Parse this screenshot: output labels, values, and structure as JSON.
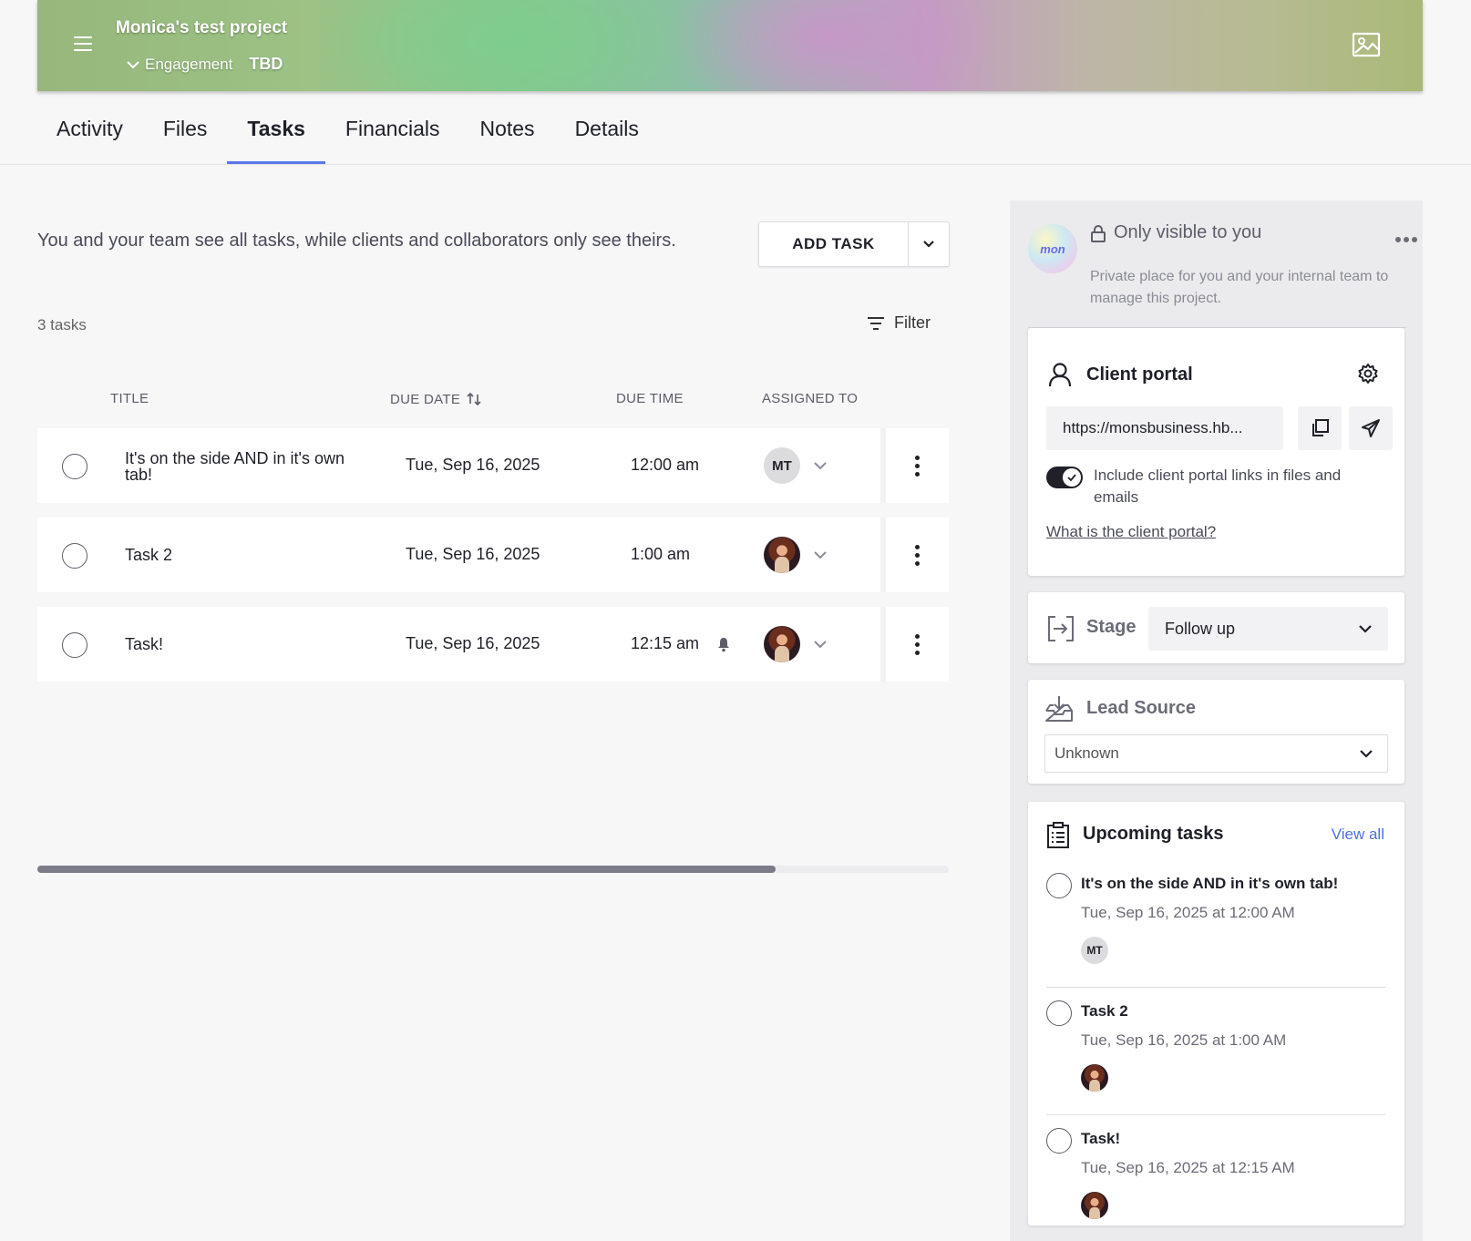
{
  "banner": {
    "project_title": "Monica's test project",
    "stage_type": "Engagement",
    "stage_value": "TBD"
  },
  "tabs": [
    {
      "label": "Activity"
    },
    {
      "label": "Files"
    },
    {
      "label": "Tasks",
      "active": true
    },
    {
      "label": "Financials"
    },
    {
      "label": "Notes"
    },
    {
      "label": "Details"
    }
  ],
  "tasks_panel": {
    "intro": "You and your team see all tasks, while clients and collaborators only see theirs.",
    "add_task_label": "ADD TASK",
    "count_label": "3 tasks",
    "filter_label": "Filter",
    "columns": {
      "title": "TITLE",
      "due_date": "DUE DATE",
      "due_time": "DUE TIME",
      "assigned_to": "ASSIGNED TO"
    },
    "rows": [
      {
        "title": "It's on the side AND in it's own tab!",
        "due_date": "Tue, Sep 16, 2025",
        "due_time": "12:00 am",
        "assignee": "MT",
        "reminder": false
      },
      {
        "title": "Task 2",
        "due_date": "Tue, Sep 16, 2025",
        "due_time": "1:00 am",
        "assignee": "photo",
        "reminder": false
      },
      {
        "title": "Task!",
        "due_date": "Tue, Sep 16, 2025",
        "due_time": "12:15 am",
        "assignee": "photo",
        "reminder": true
      }
    ],
    "scroll_position_fraction": 0.81
  },
  "sidebar": {
    "private": {
      "logo_text": "mon",
      "heading": "Only visible to you",
      "description": "Private place for you and your internal team to manage this project."
    },
    "client_portal": {
      "heading": "Client portal",
      "url": "https://monsbusiness.hb...",
      "toggle_on": true,
      "toggle_label": "Include client portal links in files and emails",
      "help_link": "What is the client portal?"
    },
    "stage": {
      "label": "Stage",
      "value": "Follow up"
    },
    "lead_source": {
      "label": "Lead Source",
      "value": "Unknown"
    },
    "upcoming": {
      "heading": "Upcoming tasks",
      "view_all": "View all",
      "items": [
        {
          "name": "It's on the side AND in it's own tab!",
          "when": "Tue, Sep 16, 2025 at 12:00 AM",
          "assignee": "MT"
        },
        {
          "name": "Task 2",
          "when": "Tue, Sep 16, 2025 at 1:00 AM",
          "assignee": "photo"
        },
        {
          "name": "Task!",
          "when": "Tue, Sep 16, 2025 at 12:15 AM",
          "assignee": "photo"
        }
      ]
    }
  },
  "colors": {
    "accent": "#5a76e8",
    "link": "#4a6fe0",
    "text": "#1f2028"
  }
}
